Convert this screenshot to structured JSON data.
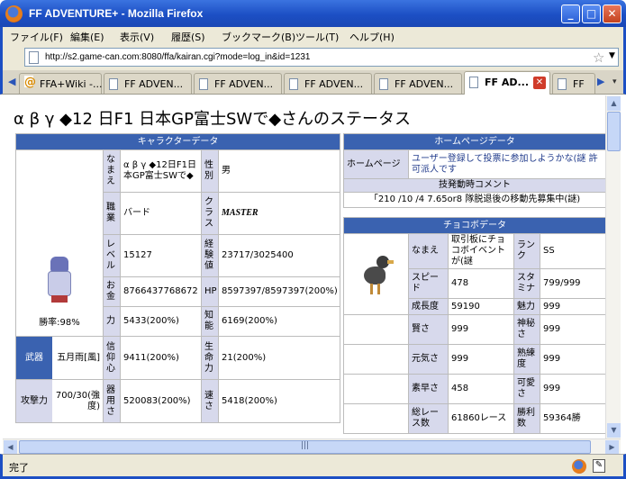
{
  "window": {
    "title": "FF ADVENTURE+ - Mozilla Firefox"
  },
  "menu": [
    "ファイル(F)",
    "編集(E)",
    "表示(V)",
    "履歴(S)",
    "ブックマーク(B)",
    "ツール(T)",
    "ヘルプ(H)"
  ],
  "address": {
    "url": "http://s2.game-can.com:8080/ffa/kairan.cgi?mode=log_in&id=1231"
  },
  "tabs": [
    {
      "label": "FFA+Wiki -..."
    },
    {
      "label": "FF ADVEN..."
    },
    {
      "label": "FF ADVEN..."
    },
    {
      "label": "FF ADVEN..."
    },
    {
      "label": "FF ADVEN..."
    },
    {
      "label": "FF AD..."
    },
    {
      "label": "FF"
    }
  ],
  "page": {
    "title": "α β γ ◆12 日F1 日本GP富士SWで◆さんのステータス"
  },
  "character": {
    "header": "キャラクターデータ",
    "win_rate": "勝率:98%",
    "name_label": "なまえ",
    "name_value": "α β γ ◆12日F1日本GP富士SWで◆",
    "gender_label": "性別",
    "gender_value": "男",
    "job_label": "職業",
    "job_value": "バード",
    "class_label": "クラス",
    "class_value": "MASTER",
    "level_label": "レベル",
    "level_value": "15127",
    "exp_label": "経験値",
    "exp_value": "23717/3025400",
    "gold_label": "お金",
    "gold_value": "8766437768672",
    "hp_label": "HP",
    "hp_value": "8597397/8597397(200%)",
    "str_label": "力",
    "str_value": "5433(200%)",
    "int_label": "知能",
    "int_value": "6169(200%)",
    "weapon_label": "武器",
    "weapon_value": "五月雨[風]",
    "faith_label": "信仰心",
    "faith_value": "9411(200%)",
    "vit_label": "生命力",
    "vit_value": "21(200%)",
    "atk_label": "攻撃力",
    "atk_value": "700/30(強度)",
    "dex_label": "器用さ",
    "dex_value": "520083(200%)",
    "spd_label": "速さ",
    "spd_value": "5418(200%)"
  },
  "homepage": {
    "header": "ホームページデータ",
    "label": "ホームページ",
    "value": "ユーザー登録して投票に参加しようかな(謎 許可派人です",
    "comment_header": "技発動時コメント",
    "comment_value": "「210 /10 /4 7.65or8 隊脱退後の移動先募集中(謎)"
  },
  "chocobo": {
    "header": "チョコボデータ",
    "name_label": "なまえ",
    "name_value": "取引板にチョコボイベントが(謎",
    "rank_label": "ランク",
    "rank_value": "SS",
    "speed_label": "スピード",
    "speed_value": "478",
    "stamina_label": "スタミナ",
    "stamina_value": "799/999",
    "growth_label": "成長度",
    "growth_value": "59190",
    "charm_label": "魅力",
    "charm_value": "999",
    "wisdom_label": "賢さ",
    "wisdom_value": "999",
    "mystic_label": "神秘さ",
    "mystic_value": "999",
    "energy_label": "元気さ",
    "energy_value": "999",
    "skill_label": "熟練度",
    "skill_value": "999",
    "quick_label": "素早さ",
    "quick_value": "458",
    "cute_label": "可愛さ",
    "cute_value": "999",
    "races_label": "総レース数",
    "races_value": "61860レース",
    "wins_label": "勝利数",
    "wins_value": "59364勝"
  },
  "status": {
    "text": "完了"
  }
}
